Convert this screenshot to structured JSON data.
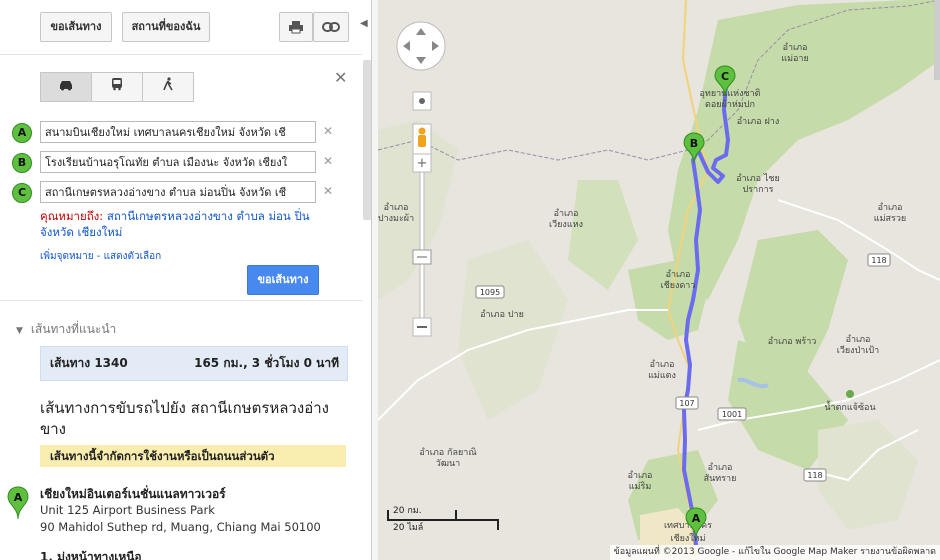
{
  "toolbar": {
    "directions_label": "ขอเส้นทาง",
    "my_places_label": "สถานที่ของฉัน",
    "print_icon": "print-icon",
    "link_icon": "link-icon"
  },
  "modes": [
    "car-icon",
    "bus-icon",
    "walk-icon"
  ],
  "waypoints": [
    {
      "marker": "A",
      "value": "สนามบินเชียงใหม่ เทศบาลนครเชียงใหม่ จังหวัด เชี"
    },
    {
      "marker": "B",
      "value": "โรงเรียนบ้านอรุโณทัย ตำบล เมืองนะ จังหวัด เชียงใ"
    },
    {
      "marker": "C",
      "value": "สถานีเกษตรหลวงอ่างขาง ตำบล ม่อนปิ่น จังหวัด เชี"
    }
  ],
  "destination_note": {
    "prefix": "คุณหมายถึง:",
    "link": "สถานีเกษตรหลวงอ่างขาง ตำบล ม่อน ปิ่น จังหวัด เชียงใหม่"
  },
  "extra_links": "เพิ่มจุดหมาย - แสดงตัวเลือก",
  "go_button": "ขอเส้นทาง",
  "suggested_heading": "เส้นทางที่แนะนำ",
  "route": {
    "name": "เส้นทาง 1340",
    "info": "165 กม., 3 ชั่วโมง 0 นาที"
  },
  "directions_title": "เส้นทางการขับรถไปยัง สถานีเกษตรหลวงอ่างขาง",
  "warning": "เส้นทางนี้จำกัดการใช้งานหรือเป็นถนนส่วนตัว",
  "start": {
    "marker": "A",
    "name": "เชียงใหม่อินเตอร์เนชั่นแนลทาวเวอร์",
    "line1": "Unit 125 Airport Business Park",
    "line2": "90 Mahidol Suthep rd, Muang, Chiang Mai 50100"
  },
  "step1": "1. มุ่งหน้าทางเหนือ",
  "map": {
    "route_color": "#6b6bf0",
    "labels": [
      {
        "id": "mae-ai",
        "lines": [
          "อำเภอ",
          "แม่อาย"
        ]
      },
      {
        "id": "doi-fa-hom-pok",
        "lines": [
          "อุทยานแห่งชาติ",
          "ดอยผ้าห่มปก"
        ]
      },
      {
        "id": "fang",
        "lines": [
          "อำเภอ ฝาง"
        ]
      },
      {
        "id": "chai-prakan",
        "lines": [
          "อำเภอ ไชย",
          "ปราการ"
        ]
      },
      {
        "id": "mae-suai",
        "lines": [
          "อำเภอ",
          "แม่สรวย"
        ]
      },
      {
        "id": "pang-mapha",
        "lines": [
          "อำเภอ",
          "ปางมะผ้า"
        ]
      },
      {
        "id": "wiang-haeng",
        "lines": [
          "อำเภอ",
          "เวียงแหง"
        ]
      },
      {
        "id": "chiang-dao",
        "lines": [
          "อำเภอ",
          "เชียงดาว"
        ]
      },
      {
        "id": "pai",
        "lines": [
          "อำเภอ ปาย"
        ]
      },
      {
        "id": "phrao",
        "lines": [
          "อำเภอ พร้าว"
        ]
      },
      {
        "id": "wiang-pa-pao",
        "lines": [
          "อำเภอ",
          "เวียงป่าเป้า"
        ]
      },
      {
        "id": "mae-taeng",
        "lines": [
          "อำเภอ",
          "แม่แตง"
        ]
      },
      {
        "id": "nam-tok-mae-sa",
        "lines": [
          "น้ำตกแจ้ซ้อน"
        ]
      },
      {
        "id": "galyani",
        "lines": [
          "อำเภอ กัลยาณิ",
          "วัฒนา"
        ]
      },
      {
        "id": "mae-rim",
        "lines": [
          "อำเภอ",
          "แม่ริม"
        ]
      },
      {
        "id": "san-sai",
        "lines": [
          "อำเภอ",
          "สันทราย"
        ]
      },
      {
        "id": "chiang-mai-city",
        "lines": [
          "เทศบาลนคร",
          "เชียงใหม่"
        ]
      }
    ],
    "road_shields": [
      "1095",
      "107",
      "1001",
      "118",
      "118"
    ],
    "waypoint_markers": [
      "A",
      "B",
      "C"
    ],
    "scale": {
      "km": "20 กม.",
      "mi": "20 ไมล์"
    },
    "copyright": "ข้อมูลแผนที่ ©2013 Google - แก้ไขใน Google Map Maker   รายงานข้อผิดพลาด"
  }
}
